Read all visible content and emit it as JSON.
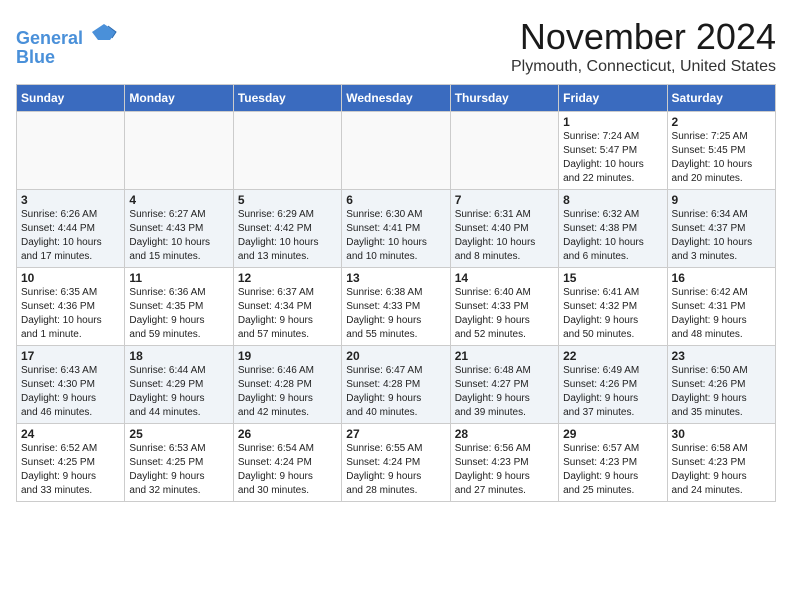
{
  "logo": {
    "line1": "General",
    "line2": "Blue"
  },
  "header": {
    "month": "November 2024",
    "location": "Plymouth, Connecticut, United States"
  },
  "weekdays": [
    "Sunday",
    "Monday",
    "Tuesday",
    "Wednesday",
    "Thursday",
    "Friday",
    "Saturday"
  ],
  "weeks": [
    [
      {
        "day": "",
        "info": ""
      },
      {
        "day": "",
        "info": ""
      },
      {
        "day": "",
        "info": ""
      },
      {
        "day": "",
        "info": ""
      },
      {
        "day": "",
        "info": ""
      },
      {
        "day": "1",
        "info": "Sunrise: 7:24 AM\nSunset: 5:47 PM\nDaylight: 10 hours\nand 22 minutes."
      },
      {
        "day": "2",
        "info": "Sunrise: 7:25 AM\nSunset: 5:45 PM\nDaylight: 10 hours\nand 20 minutes."
      }
    ],
    [
      {
        "day": "3",
        "info": "Sunrise: 6:26 AM\nSunset: 4:44 PM\nDaylight: 10 hours\nand 17 minutes."
      },
      {
        "day": "4",
        "info": "Sunrise: 6:27 AM\nSunset: 4:43 PM\nDaylight: 10 hours\nand 15 minutes."
      },
      {
        "day": "5",
        "info": "Sunrise: 6:29 AM\nSunset: 4:42 PM\nDaylight: 10 hours\nand 13 minutes."
      },
      {
        "day": "6",
        "info": "Sunrise: 6:30 AM\nSunset: 4:41 PM\nDaylight: 10 hours\nand 10 minutes."
      },
      {
        "day": "7",
        "info": "Sunrise: 6:31 AM\nSunset: 4:40 PM\nDaylight: 10 hours\nand 8 minutes."
      },
      {
        "day": "8",
        "info": "Sunrise: 6:32 AM\nSunset: 4:38 PM\nDaylight: 10 hours\nand 6 minutes."
      },
      {
        "day": "9",
        "info": "Sunrise: 6:34 AM\nSunset: 4:37 PM\nDaylight: 10 hours\nand 3 minutes."
      }
    ],
    [
      {
        "day": "10",
        "info": "Sunrise: 6:35 AM\nSunset: 4:36 PM\nDaylight: 10 hours\nand 1 minute."
      },
      {
        "day": "11",
        "info": "Sunrise: 6:36 AM\nSunset: 4:35 PM\nDaylight: 9 hours\nand 59 minutes."
      },
      {
        "day": "12",
        "info": "Sunrise: 6:37 AM\nSunset: 4:34 PM\nDaylight: 9 hours\nand 57 minutes."
      },
      {
        "day": "13",
        "info": "Sunrise: 6:38 AM\nSunset: 4:33 PM\nDaylight: 9 hours\nand 55 minutes."
      },
      {
        "day": "14",
        "info": "Sunrise: 6:40 AM\nSunset: 4:33 PM\nDaylight: 9 hours\nand 52 minutes."
      },
      {
        "day": "15",
        "info": "Sunrise: 6:41 AM\nSunset: 4:32 PM\nDaylight: 9 hours\nand 50 minutes."
      },
      {
        "day": "16",
        "info": "Sunrise: 6:42 AM\nSunset: 4:31 PM\nDaylight: 9 hours\nand 48 minutes."
      }
    ],
    [
      {
        "day": "17",
        "info": "Sunrise: 6:43 AM\nSunset: 4:30 PM\nDaylight: 9 hours\nand 46 minutes."
      },
      {
        "day": "18",
        "info": "Sunrise: 6:44 AM\nSunset: 4:29 PM\nDaylight: 9 hours\nand 44 minutes."
      },
      {
        "day": "19",
        "info": "Sunrise: 6:46 AM\nSunset: 4:28 PM\nDaylight: 9 hours\nand 42 minutes."
      },
      {
        "day": "20",
        "info": "Sunrise: 6:47 AM\nSunset: 4:28 PM\nDaylight: 9 hours\nand 40 minutes."
      },
      {
        "day": "21",
        "info": "Sunrise: 6:48 AM\nSunset: 4:27 PM\nDaylight: 9 hours\nand 39 minutes."
      },
      {
        "day": "22",
        "info": "Sunrise: 6:49 AM\nSunset: 4:26 PM\nDaylight: 9 hours\nand 37 minutes."
      },
      {
        "day": "23",
        "info": "Sunrise: 6:50 AM\nSunset: 4:26 PM\nDaylight: 9 hours\nand 35 minutes."
      }
    ],
    [
      {
        "day": "24",
        "info": "Sunrise: 6:52 AM\nSunset: 4:25 PM\nDaylight: 9 hours\nand 33 minutes."
      },
      {
        "day": "25",
        "info": "Sunrise: 6:53 AM\nSunset: 4:25 PM\nDaylight: 9 hours\nand 32 minutes."
      },
      {
        "day": "26",
        "info": "Sunrise: 6:54 AM\nSunset: 4:24 PM\nDaylight: 9 hours\nand 30 minutes."
      },
      {
        "day": "27",
        "info": "Sunrise: 6:55 AM\nSunset: 4:24 PM\nDaylight: 9 hours\nand 28 minutes."
      },
      {
        "day": "28",
        "info": "Sunrise: 6:56 AM\nSunset: 4:23 PM\nDaylight: 9 hours\nand 27 minutes."
      },
      {
        "day": "29",
        "info": "Sunrise: 6:57 AM\nSunset: 4:23 PM\nDaylight: 9 hours\nand 25 minutes."
      },
      {
        "day": "30",
        "info": "Sunrise: 6:58 AM\nSunset: 4:23 PM\nDaylight: 9 hours\nand 24 minutes."
      }
    ]
  ]
}
